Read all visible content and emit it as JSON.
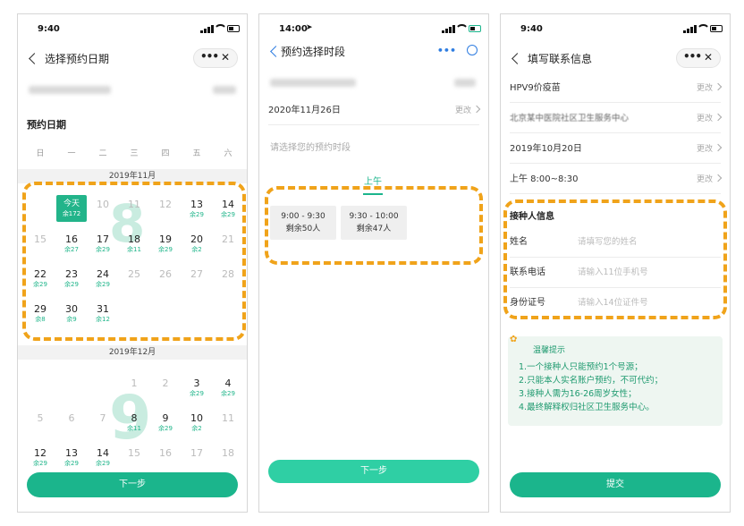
{
  "colors": {
    "accent": "#1bb58c",
    "highlight": "#f0a31a"
  },
  "screen1": {
    "time": "9:40",
    "title": "选择预约日期",
    "section": "预约日期",
    "weekdays": [
      "日",
      "一",
      "二",
      "三",
      "四",
      "五",
      "六"
    ],
    "months": [
      "2019年11月",
      "2019年12月"
    ],
    "nov": [
      {
        "n": "今天",
        "r": "余172",
        "today": true
      },
      {
        "n": "10",
        "dis": true
      },
      {
        "n": "11",
        "dis": true
      },
      {
        "n": "12",
        "dis": true
      },
      {
        "n": "13",
        "r": "余29"
      },
      {
        "n": "14",
        "r": "余29"
      },
      {
        "n": "15",
        "dis": true
      },
      {
        "n": "16",
        "r": "余27"
      },
      {
        "n": "17",
        "r": "余29"
      },
      {
        "n": "18",
        "r": "余11"
      },
      {
        "n": "19",
        "r": "余29"
      },
      {
        "n": "20",
        "r": "余2"
      },
      {
        "n": "21",
        "dis": true
      },
      {
        "n": "22",
        "r": "余29"
      },
      {
        "n": "23",
        "r": "余29"
      },
      {
        "n": "24",
        "r": "余29"
      },
      {
        "n": "25",
        "dis": true
      },
      {
        "n": "26",
        "dis": true
      },
      {
        "n": "27",
        "dis": true
      },
      {
        "n": "28",
        "dis": true
      },
      {
        "n": "29",
        "r": "余8"
      },
      {
        "n": "30",
        "r": "余9"
      },
      {
        "n": "31",
        "r": "余12"
      }
    ],
    "dec": [
      {
        "n": "1",
        "dis": true
      },
      {
        "n": "2",
        "dis": true
      },
      {
        "n": "3",
        "r": "余29"
      },
      {
        "n": "4",
        "r": "余29"
      },
      {
        "n": "5",
        "dis": true
      },
      {
        "n": "6",
        "dis": true
      },
      {
        "n": "7",
        "dis": true
      },
      {
        "n": "8",
        "r": "余11"
      },
      {
        "n": "9",
        "r": "余29"
      },
      {
        "n": "10",
        "r": "余2"
      },
      {
        "n": "11",
        "dis": true
      },
      {
        "n": "12",
        "r": "余29"
      },
      {
        "n": "13",
        "r": "余29"
      },
      {
        "n": "14",
        "r": "余29"
      },
      {
        "n": "15",
        "dis": true
      },
      {
        "n": "16",
        "dis": true
      },
      {
        "n": "17",
        "dis": true
      },
      {
        "n": "18",
        "dis": true
      }
    ],
    "watermarks": [
      "8",
      "9"
    ],
    "next": "下一步"
  },
  "screen2": {
    "time": "14:00",
    "title": "预约选择时段",
    "date": "2020年11月26日",
    "change": "更改",
    "prompt": "请选择您的预约时段",
    "tab": "上午",
    "slots": [
      {
        "time": "9:00 - 9:30",
        "left": "剩余50人"
      },
      {
        "time": "9:30 - 10:00",
        "left": "剩余47人"
      }
    ],
    "next": "下一步"
  },
  "screen3": {
    "time": "9:40",
    "title": "填写联系信息",
    "rows": [
      {
        "label": "HPV9价疫苗"
      },
      {
        "label": "北京某中医院社区卫生服务中心"
      },
      {
        "label": "2019年10月20日"
      },
      {
        "label": "上午 8:00~8:30"
      }
    ],
    "change": "更改",
    "info_title": "接种人信息",
    "fields": [
      {
        "label": "姓名",
        "placeholder": "请填写您的姓名"
      },
      {
        "label": "联系电话",
        "placeholder": "请输入11位手机号"
      },
      {
        "label": "身份证号",
        "placeholder": "请输入14位证件号"
      }
    ],
    "tips_title": "温馨提示",
    "tips": [
      "1.一个接种人只能预约1个号源；",
      "2.只能本人实名账户预约，不可代约；",
      "3.接种人需为16-26周岁女性；",
      "4.最终解释权归社区卫生服务中心。"
    ],
    "submit": "提交"
  }
}
